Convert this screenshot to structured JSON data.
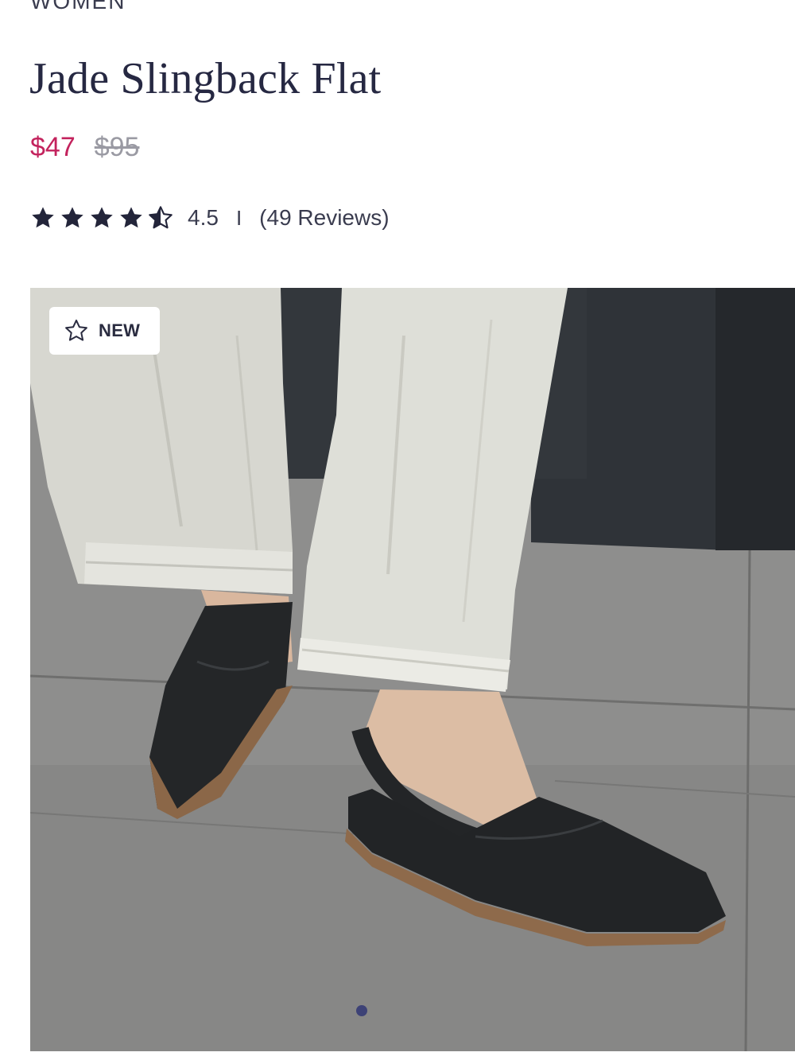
{
  "product": {
    "category": "WOMEN",
    "title": "Jade Slingback Flat",
    "price_sale": "$47",
    "price_original": "$95",
    "rating_value": "4.5",
    "rating_stars": 4.5,
    "rating_max": 5,
    "rating_separator": "I",
    "reviews_label": "(49 Reviews)"
  },
  "gallery": {
    "badge_label": "NEW",
    "badge_icon": "star-outline-icon",
    "active_slide": 1,
    "slide_count": 1
  },
  "colors": {
    "sale_price": "#c3235d",
    "original_price": "#9a9aa3",
    "title": "#262842",
    "stars": "#23253a",
    "active_dot": "#3d4276"
  }
}
